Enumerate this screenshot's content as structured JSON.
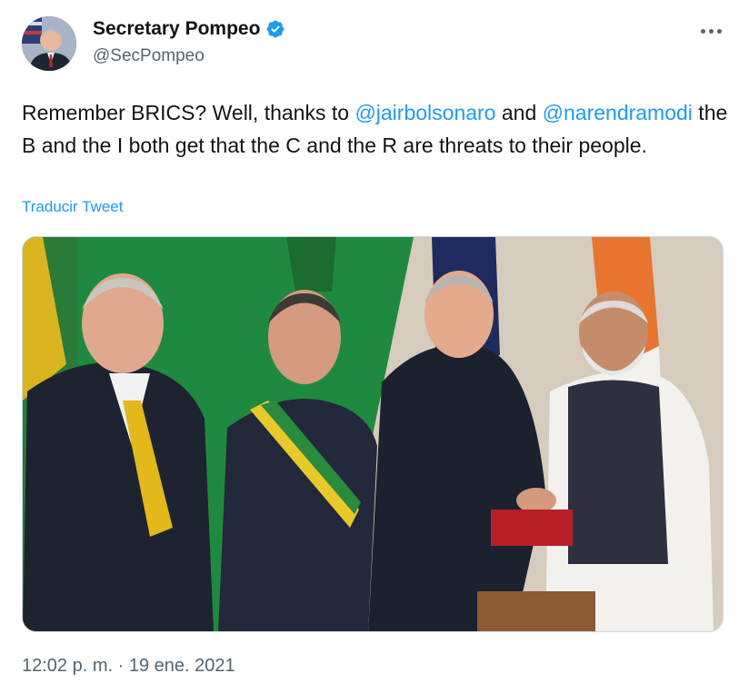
{
  "author": {
    "display_name": "Secretary Pompeo",
    "handle": "@SecPompeo",
    "verified": true
  },
  "tweet": {
    "text_segments": [
      {
        "type": "text",
        "value": "Remember BRICS? Well, thanks to "
      },
      {
        "type": "mention",
        "value": "@jairbolsonaro"
      },
      {
        "type": "text",
        "value": " and "
      },
      {
        "type": "mention",
        "value": "@narendramodi"
      },
      {
        "type": "text",
        "value": " the B and the I both get that the C and the R are threats to their people."
      }
    ],
    "translate_label": "Traducir Tweet",
    "timestamp": "12:02 p. m. · 19 ene. 2021"
  },
  "icons": {
    "verified": "verified-badge-icon",
    "more": "more-options-icon"
  },
  "colors": {
    "link": "#1d9bf0",
    "secondary_text": "#536471",
    "primary_text": "#0f1419",
    "border": "#cfd9de"
  }
}
